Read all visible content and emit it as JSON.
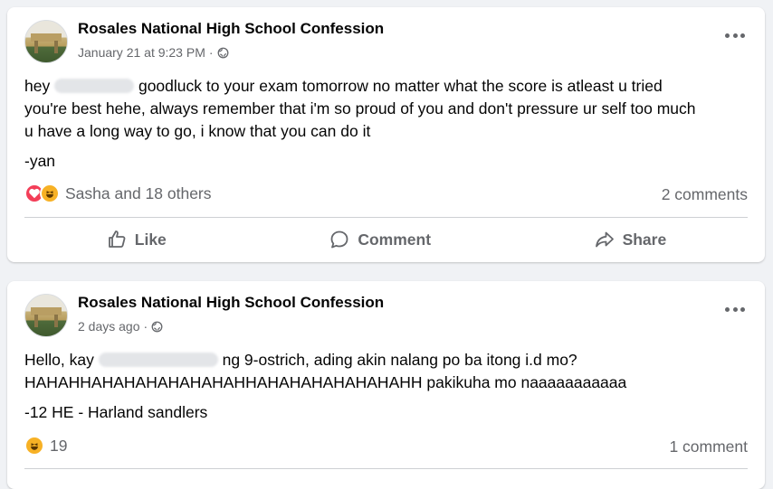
{
  "posts": [
    {
      "page_name": "Rosales National High School Confession",
      "timestamp": "January 21 at 9:23 PM",
      "separator": "·",
      "audience_icon": "globe-icon",
      "body": {
        "line1_start": "hey",
        "line1_end": "goodluck to your exam tomorrow no matter what the score is atleast u tried",
        "line2": "you're best hehe, always remember that i'm so proud of you and don't pressure ur self too much",
        "line3": "u have a long way to go, i know that you can do it"
      },
      "signature": "-yan",
      "reactions": {
        "icons": [
          "love",
          "haha"
        ],
        "summary": "Sasha and 18 others"
      },
      "comments_count": "2 comments",
      "actions": {
        "like": "Like",
        "comment": "Comment",
        "share": "Share"
      }
    },
    {
      "page_name": "Rosales National High School Confession",
      "timestamp": "2 days ago",
      "separator": "·",
      "audience_icon": "globe-icon",
      "body": {
        "line1_start": "Hello, kay",
        "line1_end": "ng 9-ostrich, ading akin nalang po ba itong i.d mo?",
        "line2": "HAHAHHAHAHAHAHAHAHAHHAHAHAHAHAHAHAHH pakikuha mo naaaaaaaaaaa"
      },
      "signature": "-12 HE - Harland sandlers",
      "reactions": {
        "icons": [
          "haha"
        ],
        "summary": "19"
      },
      "comments_count": "1 comment"
    }
  ],
  "colors": {
    "background": "#f0f2f5",
    "card": "#ffffff",
    "secondary_text": "#65676b",
    "love": "#f33e58",
    "haha": "#f7b125"
  }
}
